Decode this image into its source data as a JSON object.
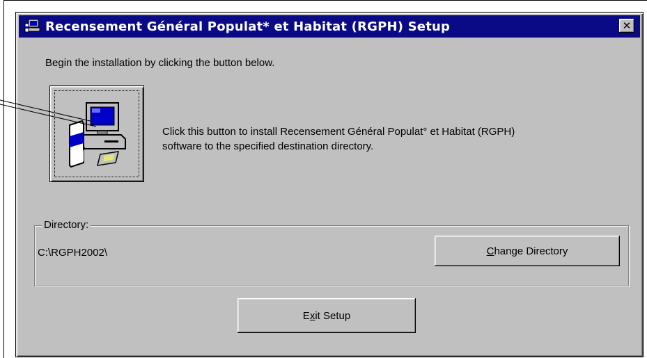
{
  "window": {
    "title": "Recensement Général Populat* et Habitat (RGPH) Setup",
    "close_label": "✕"
  },
  "instruction": "Begin the installation by clicking the button below.",
  "install": {
    "description_line1": "Click this button to install Recensement Général Populat° et Habitat (RGPH)",
    "description_line2": "software to the specified destination directory."
  },
  "directory": {
    "legend": "Directory:",
    "path": "C:\\RGPH2002\\",
    "change_prefix": "",
    "change_mnemonic": "C",
    "change_rest": "hange Directory"
  },
  "exit": {
    "prefix": "E",
    "mnemonic": "x",
    "rest": "it Setup"
  },
  "colors": {
    "titlebar": "#0a0a86",
    "face": "#c0c0c0"
  },
  "icons": [
    "setup-computer-icon",
    "install-computer-icon",
    "close-icon"
  ]
}
